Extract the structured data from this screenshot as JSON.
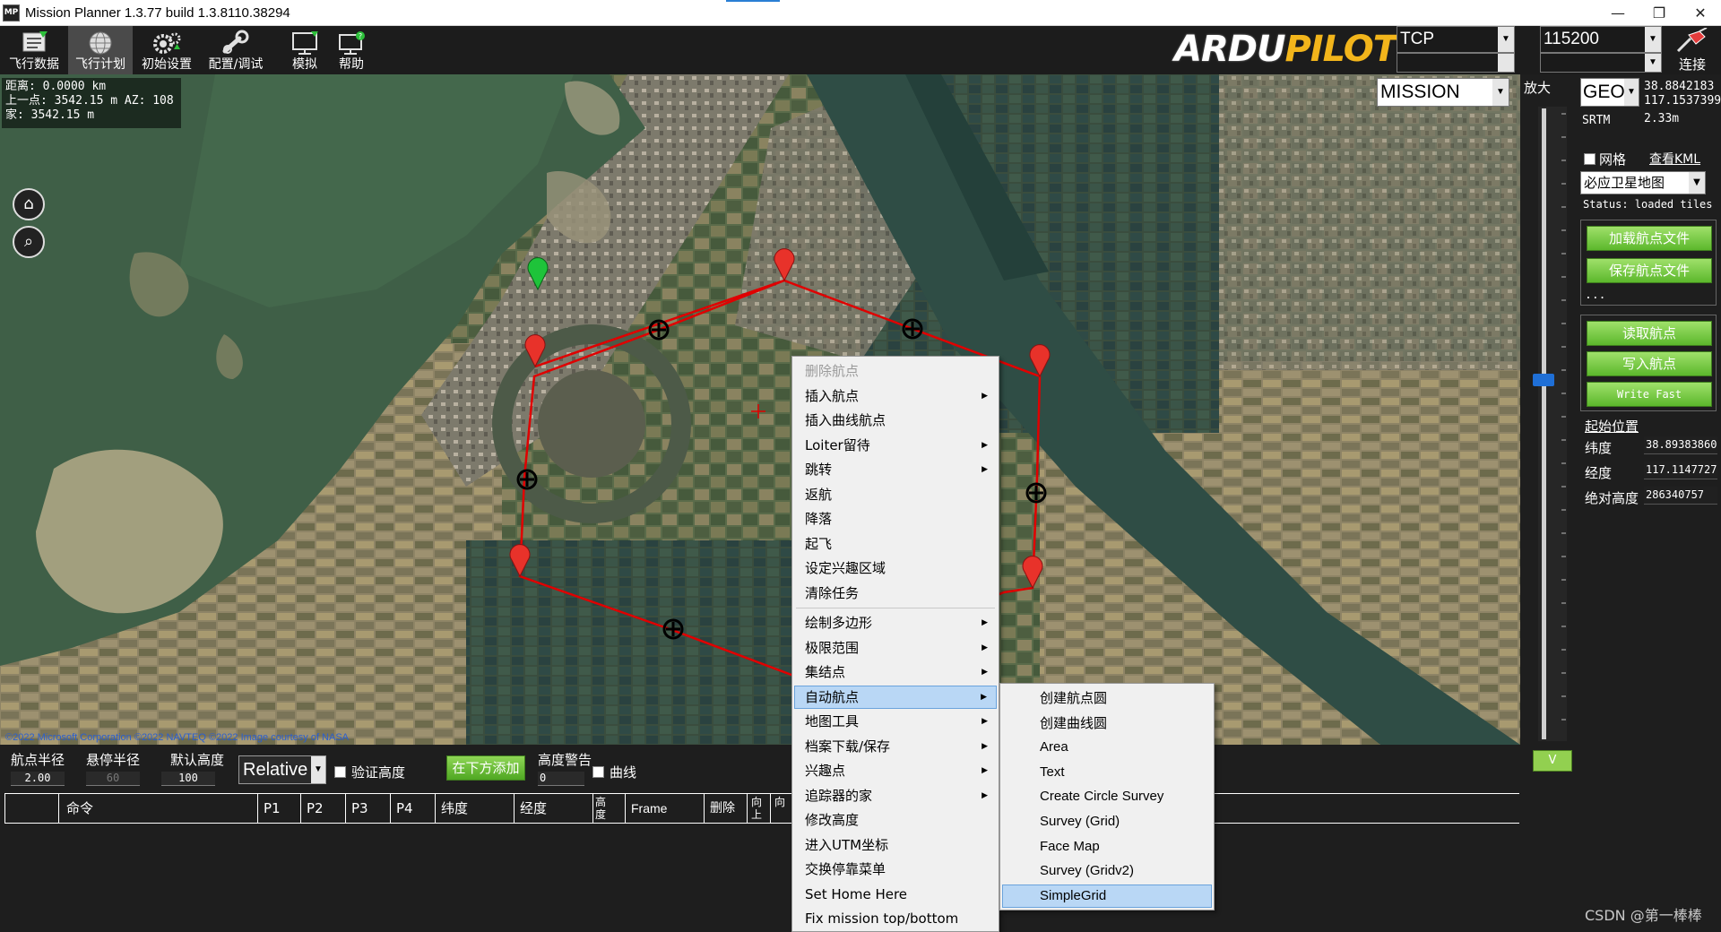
{
  "window": {
    "title": "Mission Planner 1.3.77 build 1.3.8110.38294",
    "icon_label": "MP",
    "minimize_label": "—",
    "restore_label": "❐",
    "close_label": "✕"
  },
  "toolbar": {
    "items": [
      {
        "label": "飞行数据",
        "icon": "flight-data-icon"
      },
      {
        "label": "飞行计划",
        "icon": "globe-icon",
        "active": true
      },
      {
        "label": "初始设置",
        "icon": "gears-icon"
      },
      {
        "label": "配置/调试",
        "icon": "wrench-icon"
      },
      {
        "label": "模拟",
        "icon": "monitor-icon"
      },
      {
        "label": "帮助",
        "icon": "help-monitor-icon"
      }
    ],
    "logo_text_a": "ARDU",
    "logo_text_b": "PILOT",
    "connection_type": "TCP",
    "baud_rate": "115200",
    "connect_label": "连接"
  },
  "map": {
    "distance_info": {
      "line1": "距离: 0.0000 km",
      "line2": "上一点: 3542.15 m AZ: 108",
      "line3": "家: 3542.15 m"
    },
    "flight_mode": "MISSION",
    "attribution": "©2022 Microsoft Corporation ©2022 NAVTEQ ©2022 Image courtesy of NASA",
    "route_color": "#e00000",
    "home_marker_color": "#1ec33a",
    "waypoint_marker_color": "#e8322a"
  },
  "zoom": {
    "label": "放大",
    "level_fraction": 0.42,
    "toggle_label": "V"
  },
  "right_panel": {
    "coord_system": "GEO",
    "lat_display": "38.8842183",
    "lng_display": "117.1537399",
    "srtm_label": "SRTM",
    "srtm_value": "2.33m",
    "grid_label": "网格",
    "view_kml_label": "查看KML",
    "map_type": "必应卫星地图",
    "status_text": "Status: loaded tiles",
    "load_wp_file": "加载航点文件",
    "save_wp_file": "保存航点文件",
    "ellipsis": "...",
    "read_wp": "读取航点",
    "write_wp": "写入航点",
    "write_fast": "Write Fast",
    "home_location_label": "起始位置",
    "home_lat_label": "纬度",
    "home_lat_value": "38.89383860",
    "home_lng_label": "经度",
    "home_lng_value": "117.1147727",
    "home_alt_label": "绝对高度",
    "home_alt_value": "286340757"
  },
  "bottom": {
    "wp_radius_label": "航点半径",
    "wp_radius_value": "2.00",
    "loiter_radius_label": "悬停半径",
    "loiter_radius_value": "60",
    "default_alt_label": "默认高度",
    "default_alt_value": "100",
    "alt_frame": "Relative",
    "verify_height_label": "验证高度",
    "add_below_label": "在下方添加",
    "alt_warn_label": "高度警告",
    "alt_warn_value": "0",
    "spline_label": "曲线",
    "columns": [
      "",
      "命令",
      "P1",
      "P2",
      "P3",
      "P4",
      "纬度",
      "经度",
      "高度",
      "Frame",
      "删除",
      "向上",
      "向"
    ]
  },
  "context_menu": {
    "items": [
      {
        "label": "删除航点",
        "disabled": true
      },
      {
        "label": "插入航点",
        "submenu": true
      },
      {
        "label": "插入曲线航点"
      },
      {
        "label": "Loiter留待",
        "submenu": true
      },
      {
        "label": "跳转",
        "submenu": true
      },
      {
        "label": "返航"
      },
      {
        "label": "降落"
      },
      {
        "label": "起飞"
      },
      {
        "label": "设定兴趣区域"
      },
      {
        "label": "清除任务"
      },
      {
        "label": "绘制多边形",
        "submenu": true,
        "sep_before": true
      },
      {
        "label": "极限范围",
        "submenu": true
      },
      {
        "label": "集结点",
        "submenu": true
      },
      {
        "label": "自动航点",
        "submenu": true,
        "highlighted": true
      },
      {
        "label": "地图工具",
        "submenu": true
      },
      {
        "label": "档案下载/保存",
        "submenu": true
      },
      {
        "label": "兴趣点",
        "submenu": true
      },
      {
        "label": "追踪器的家",
        "submenu": true
      },
      {
        "label": "修改高度"
      },
      {
        "label": "进入UTM坐标"
      },
      {
        "label": "交换停靠菜单"
      },
      {
        "label": "Set Home Here"
      },
      {
        "label": "Fix mission top/bottom"
      }
    ],
    "submenu_arrow": "▶"
  },
  "auto_wp_submenu": {
    "items": [
      {
        "label": "创建航点圆",
        "cjk": true
      },
      {
        "label": "创建曲线圆",
        "cjk": true
      },
      {
        "label": "Area"
      },
      {
        "label": "Text"
      },
      {
        "label": "Create Circle Survey"
      },
      {
        "label": "Survey (Grid)"
      },
      {
        "label": "Face Map"
      },
      {
        "label": "Survey (Gridv2)"
      },
      {
        "label": "SimpleGrid",
        "highlighted": true
      }
    ]
  },
  "watermark": "CSDN @第一棒棒"
}
